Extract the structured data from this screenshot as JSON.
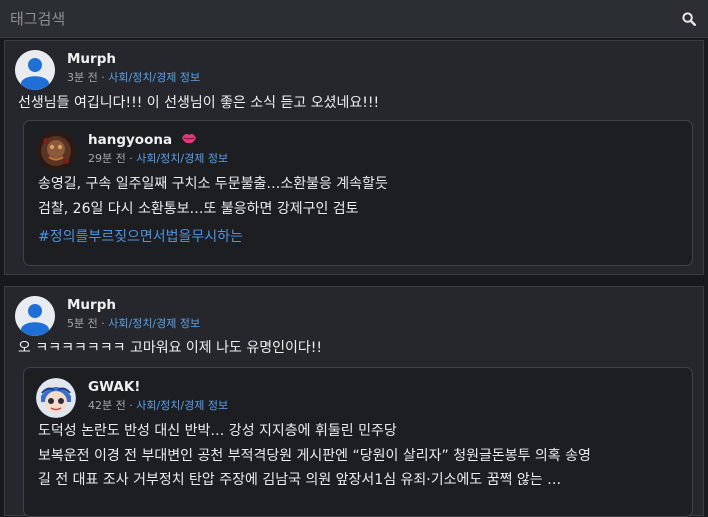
{
  "search": {
    "placeholder": "태그검색"
  },
  "posts": [
    {
      "author": "Murph",
      "time": "3분 전",
      "separator": "·",
      "category": "사회/정치/경제 정보",
      "text": "선생님들 여깁니다!!! 이 선생님이 좋은 소식 듣고 오셨네요!!!",
      "quote": {
        "author": "hangyoona",
        "time": "29분 전",
        "separator": "·",
        "category": "사회/정치/경제 정보",
        "lines": [
          "송영길, 구속 일주일째 구치소 두문불출…소환불응 계속할듯",
          "검찰, 26일 다시 소환통보…또 불응하면 강제구인 검토"
        ],
        "hashtag": "#정의를부르짖으면서법을무시하는"
      }
    },
    {
      "author": "Murph",
      "time": "5분 전",
      "separator": "·",
      "category": "사회/정치/경제 정보",
      "text": "오 ㅋㅋㅋㅋㅋㅋㅋ 고마워요 이제 나도 유명인이다!!",
      "quote": {
        "author": "GWAK!",
        "time": "42분 전",
        "separator": "·",
        "category": "사회/정치/경제 정보",
        "lines": [
          "도덕성 논란도 반성 대신 반박… 강성 지지층에 휘둘린 민주당",
          "보복운전 이경 전 부대변인 공천 부적격당원 게시판엔 “당원이 살리자” 청원글돈봉투 의혹 송영",
          "길 전 대표 조사 거부정치 탄압 주장에 김남국 의원 앞장서1심 유죄·기소에도 꿈쩍 않는 …"
        ]
      }
    }
  ],
  "colors": {
    "accent": "#5aa0ea",
    "background": "#17191d",
    "card": "#25272c",
    "quote_card": "#1c1e22"
  },
  "icons": {
    "search": "search-icon",
    "lips": "lips-icon"
  }
}
